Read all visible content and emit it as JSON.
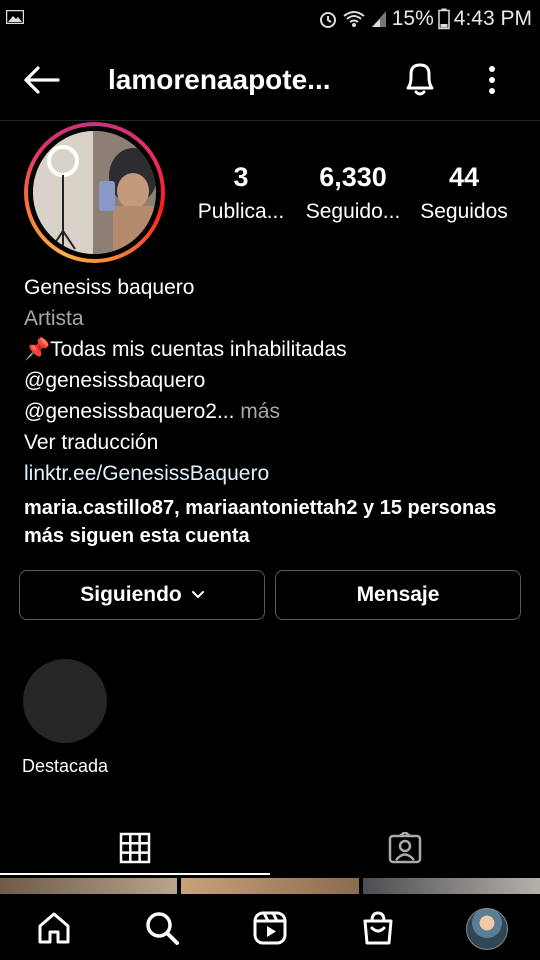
{
  "status_bar": {
    "battery_percent": "15%",
    "time": "4:43 PM",
    "icons": [
      "image-icon",
      "alarm-icon",
      "wifi-icon",
      "signal-icon",
      "battery-icon"
    ]
  },
  "header": {
    "username": "lamorenaapote...",
    "icons": [
      "back-arrow-icon",
      "bell-icon",
      "more-vertical-icon"
    ]
  },
  "profile": {
    "stats": [
      {
        "value": "3",
        "label": "Publica..."
      },
      {
        "value": "6,330",
        "label": "Seguido..."
      },
      {
        "value": "44",
        "label": "Seguidos"
      }
    ],
    "name": "Genesiss baquero",
    "category": "Artista",
    "bio_line1": "📌Todas mis cuentas inhabilitadas",
    "bio_line2": "@genesissbaquero",
    "bio_line3": "@genesissbaquero2...",
    "more_label": " más",
    "translate_label": "Ver traducción",
    "link": "linktr.ee/GenesissBaquero",
    "followed_by": "maria.castillo87, mariaantoniettah2 y 15 personas más siguen esta cuenta"
  },
  "actions": {
    "following_label": "Siguiendo",
    "message_label": "Mensaje"
  },
  "highlights": [
    {
      "label": "Destacada"
    }
  ],
  "tabs": [
    "grid-icon",
    "tagged-icon"
  ],
  "bottom_nav": [
    "home-icon",
    "search-icon",
    "reels-icon",
    "shop-icon",
    "profile-avatar"
  ],
  "colors": {
    "background": "#000000",
    "muted_text": "#a8a8a8",
    "link_text": "#e0f1ff",
    "border": "#5a5a5a",
    "highlight_circle": "#262626"
  }
}
